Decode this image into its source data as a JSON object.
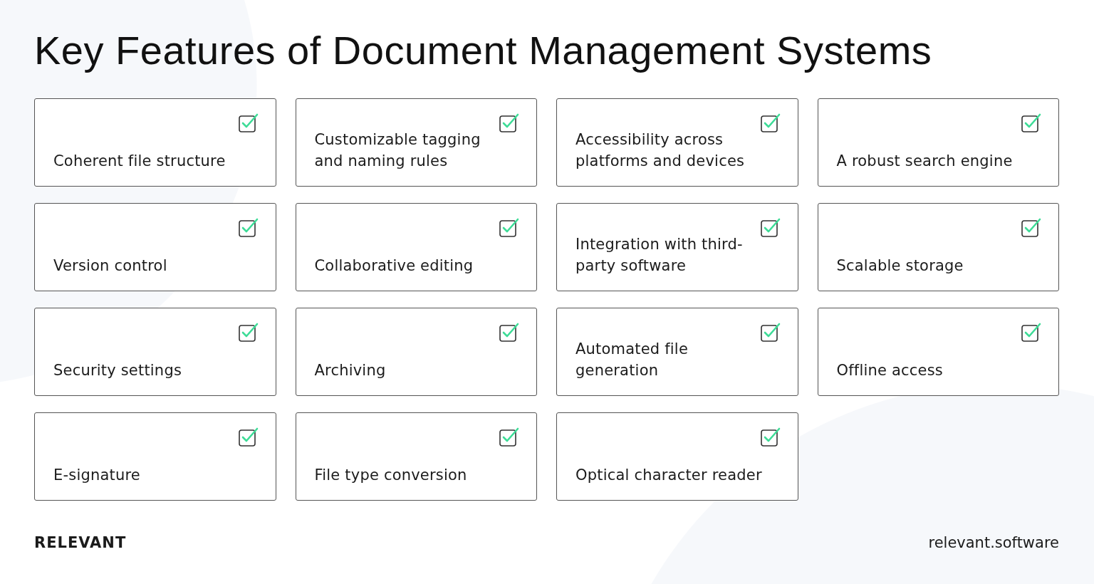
{
  "title": "Key Features of Document Management Systems",
  "features": [
    {
      "label": "Coherent file structure",
      "checked": true
    },
    {
      "label": "Customizable tagging and naming rules",
      "checked": true
    },
    {
      "label": "Accessibility across platforms and devices",
      "checked": true
    },
    {
      "label": "A robust search engine",
      "checked": true
    },
    {
      "label": "Version control",
      "checked": true
    },
    {
      "label": "Collaborative editing",
      "checked": true
    },
    {
      "label": "Integration with third-party software",
      "checked": true
    },
    {
      "label": "Scalable storage",
      "checked": true
    },
    {
      "label": "Security settings",
      "checked": true
    },
    {
      "label": "Archiving",
      "checked": true
    },
    {
      "label": "Automated file generation",
      "checked": true
    },
    {
      "label": "Offline access",
      "checked": true
    },
    {
      "label": "E-signature",
      "checked": true
    },
    {
      "label": "File type conversion",
      "checked": true
    },
    {
      "label": "Optical character reader",
      "checked": true
    }
  ],
  "footer": {
    "brand": "RELEVANT",
    "website": "relevant.software"
  }
}
